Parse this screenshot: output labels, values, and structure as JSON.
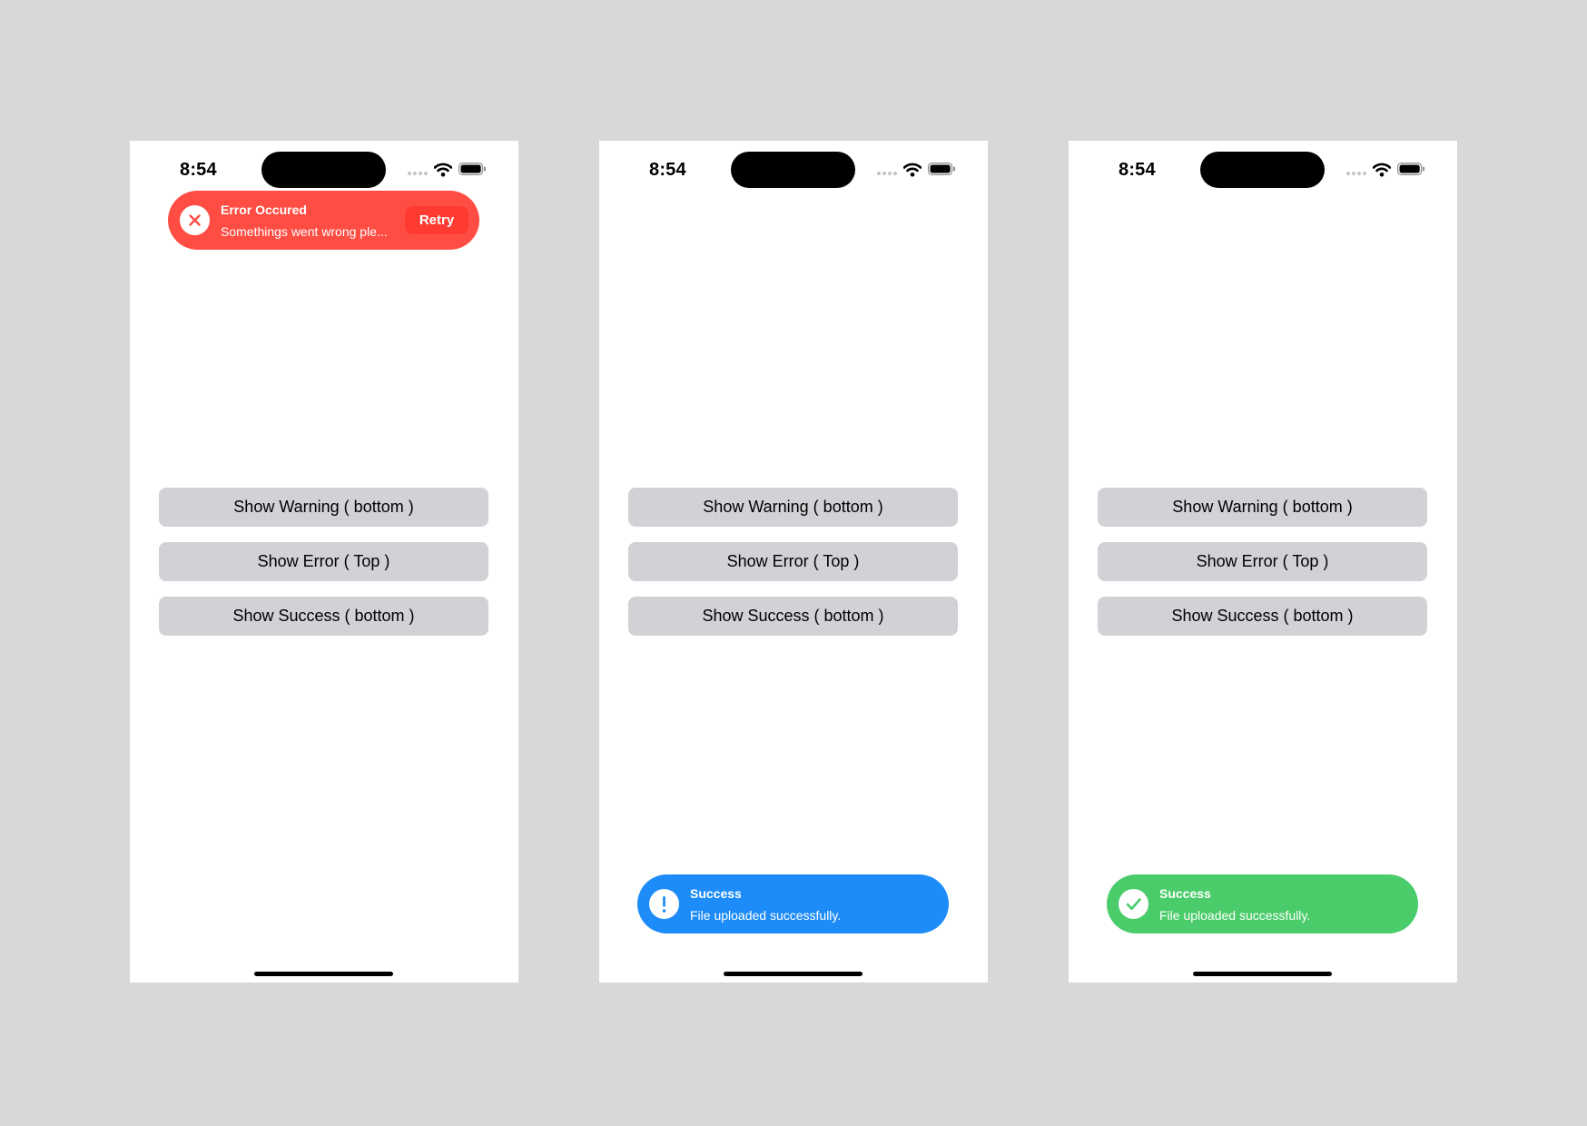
{
  "colors": {
    "background": "#d8d7d9",
    "screen": "#ffffff",
    "button_bg": "#d1d1d6",
    "error_toast": "#ff4d44",
    "error_retry_bg": "#ff3a30",
    "warning_toast": "#1d8cf8",
    "success_toast": "#4bcc6a"
  },
  "screens": [
    {
      "status_bar": {
        "time": "8:54",
        "icons": [
          "cellular-dots-icon",
          "wifi-icon",
          "battery-icon"
        ]
      },
      "buttons": {
        "warning": "Show Warning ( bottom )",
        "error": "Show Error ( Top )",
        "success": "Show Success ( bottom )"
      },
      "toast": {
        "type": "error",
        "position": "top",
        "icon": "close-icon",
        "title": "Error Occured",
        "message": "Somethings went wrong ple...",
        "action_label": "Retry"
      }
    },
    {
      "status_bar": {
        "time": "8:54",
        "icons": [
          "cellular-dots-icon",
          "wifi-icon",
          "battery-icon"
        ]
      },
      "buttons": {
        "warning": "Show Warning ( bottom )",
        "error": "Show Error ( Top )",
        "success": "Show Success ( bottom )"
      },
      "toast": {
        "type": "warning",
        "position": "bottom",
        "icon": "exclamation-icon",
        "title": "Success",
        "message": "File uploaded successfully."
      }
    },
    {
      "status_bar": {
        "time": "8:54",
        "icons": [
          "cellular-dots-icon",
          "wifi-icon",
          "battery-icon"
        ]
      },
      "buttons": {
        "warning": "Show Warning ( bottom )",
        "error": "Show Error ( Top )",
        "success": "Show Success ( bottom )"
      },
      "toast": {
        "type": "success",
        "position": "bottom",
        "icon": "checkmark-icon",
        "title": "Success",
        "message": "File uploaded successfully."
      }
    }
  ]
}
